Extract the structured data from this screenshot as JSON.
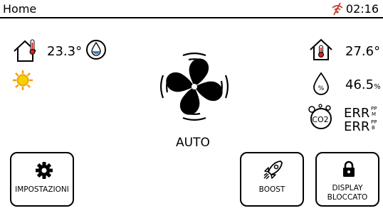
{
  "header": {
    "title": "Home",
    "time": "02:16"
  },
  "indoor": {
    "temperature": "23.3°"
  },
  "outdoor": {
    "temperature": "27.6°",
    "humidity": "46.5",
    "humidity_unit": "%"
  },
  "co2": {
    "line1": "ERR",
    "line2": "ERR",
    "sup1a": "PP",
    "sup1b": "M",
    "sup2a": "PP",
    "sup2b": "B"
  },
  "co2_icon_label": "CO2",
  "fan": {
    "mode": "AUTO"
  },
  "buttons": {
    "settings": "IMPOSTAZIONI",
    "boost": "BOOST",
    "lock_line1": "DISPLAY",
    "lock_line2": "BLOCCATO"
  },
  "colors": {
    "sun": "#f2a100",
    "sun_center": "#f7d000",
    "thermo": "#d4231c",
    "water": "#3a7fc1"
  },
  "icons": [
    "house-thermometer-icon",
    "water-drop-icon",
    "sun-icon",
    "fan-icon",
    "humidity-drop-icon",
    "co2-icon",
    "gear-icon",
    "rocket-icon",
    "padlock-icon",
    "no-wifi-icon"
  ]
}
